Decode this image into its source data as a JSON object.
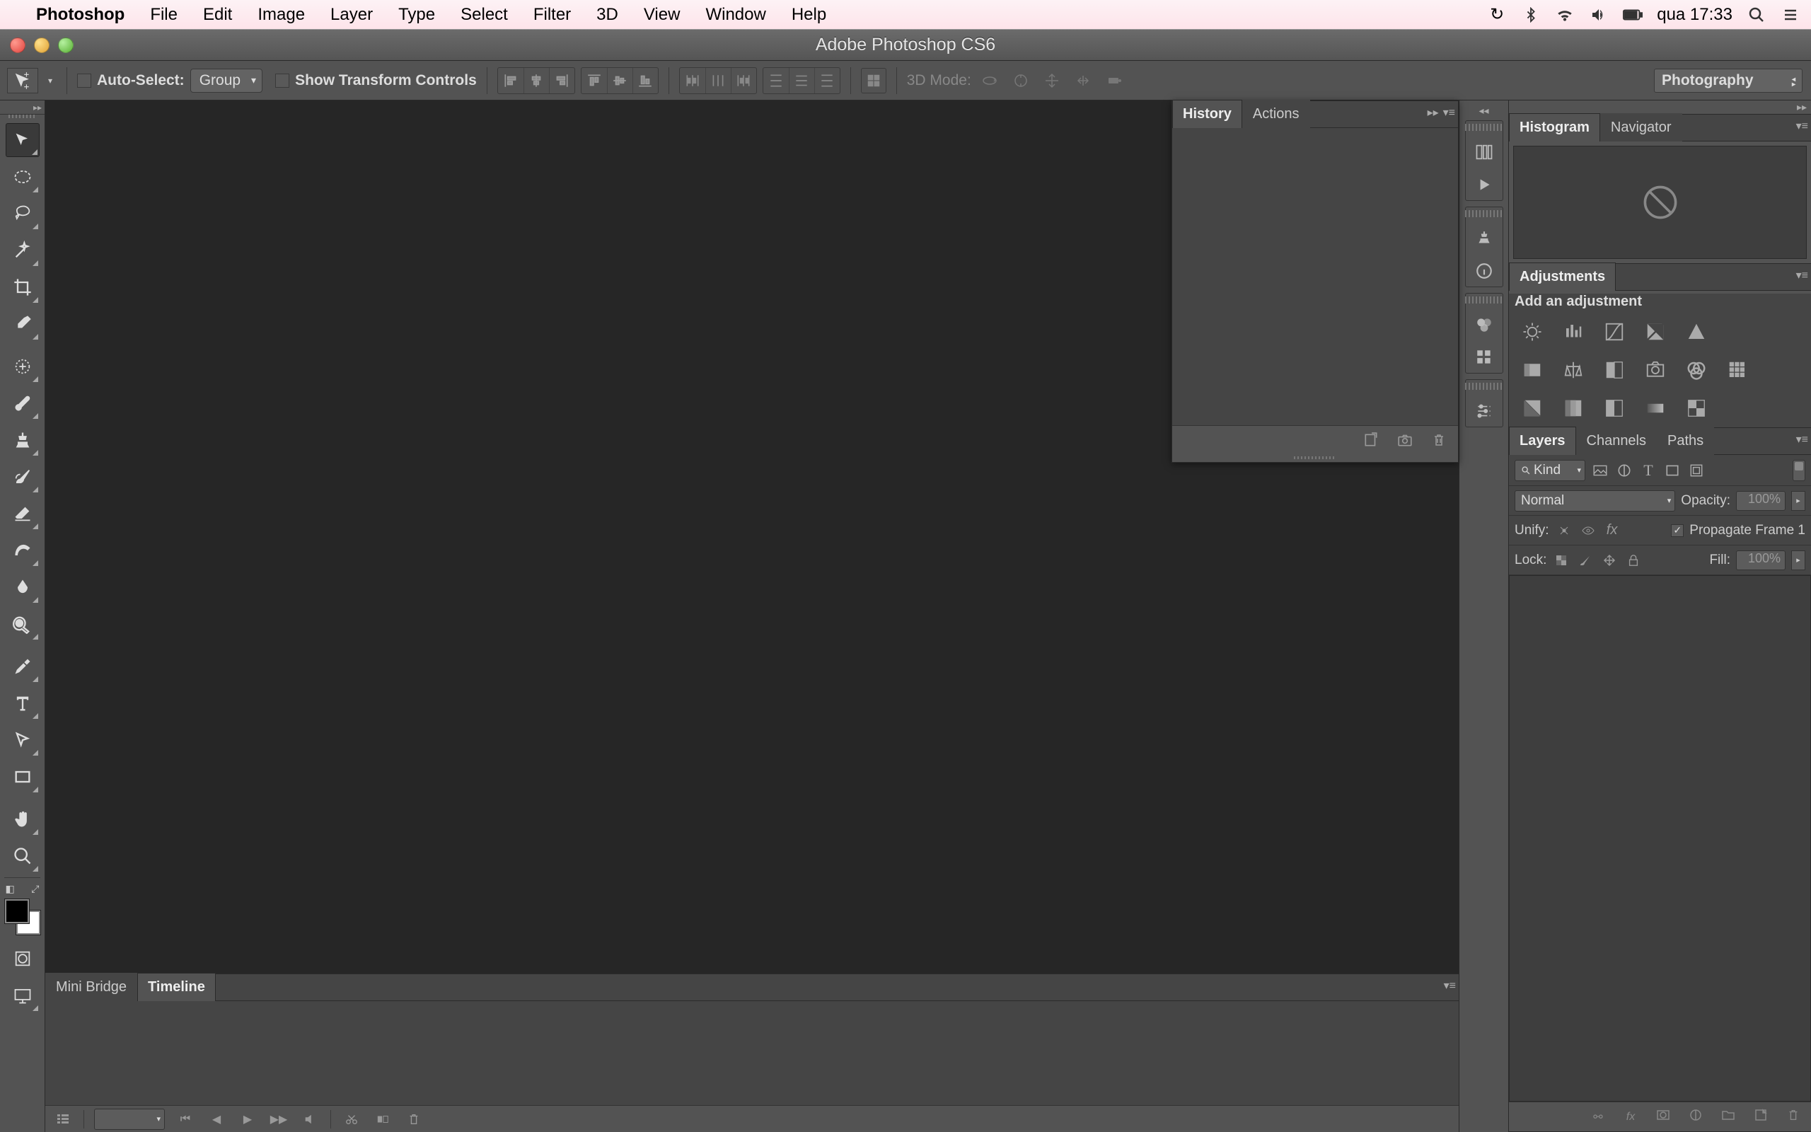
{
  "menubar": {
    "app": "Photoshop",
    "items": [
      "File",
      "Edit",
      "Image",
      "Layer",
      "Type",
      "Select",
      "Filter",
      "3D",
      "View",
      "Window",
      "Help"
    ],
    "clock": "qua 17:33"
  },
  "window": {
    "title": "Adobe Photoshop CS6"
  },
  "options": {
    "auto_select": "Auto-Select:",
    "group": "Group",
    "show_transform": "Show Transform Controls",
    "mode3d": "3D Mode:",
    "workspace": "Photography"
  },
  "history_panel": {
    "tabs": [
      "History",
      "Actions"
    ]
  },
  "bottom_panel": {
    "tabs": [
      "Mini Bridge",
      "Timeline"
    ]
  },
  "right": {
    "histogram_tab": "Histogram",
    "navigator_tab": "Navigator",
    "adjustments_tab": "Adjustments",
    "add_adjustment": "Add an adjustment",
    "layers_tab": "Layers",
    "channels_tab": "Channels",
    "paths_tab": "Paths",
    "kind": "Kind",
    "blend": "Normal",
    "opacity_label": "Opacity:",
    "opacity_value": "100%",
    "unify": "Unify:",
    "propagate": "Propagate Frame 1",
    "lock": "Lock:",
    "fill_label": "Fill:",
    "fill_value": "100%"
  }
}
